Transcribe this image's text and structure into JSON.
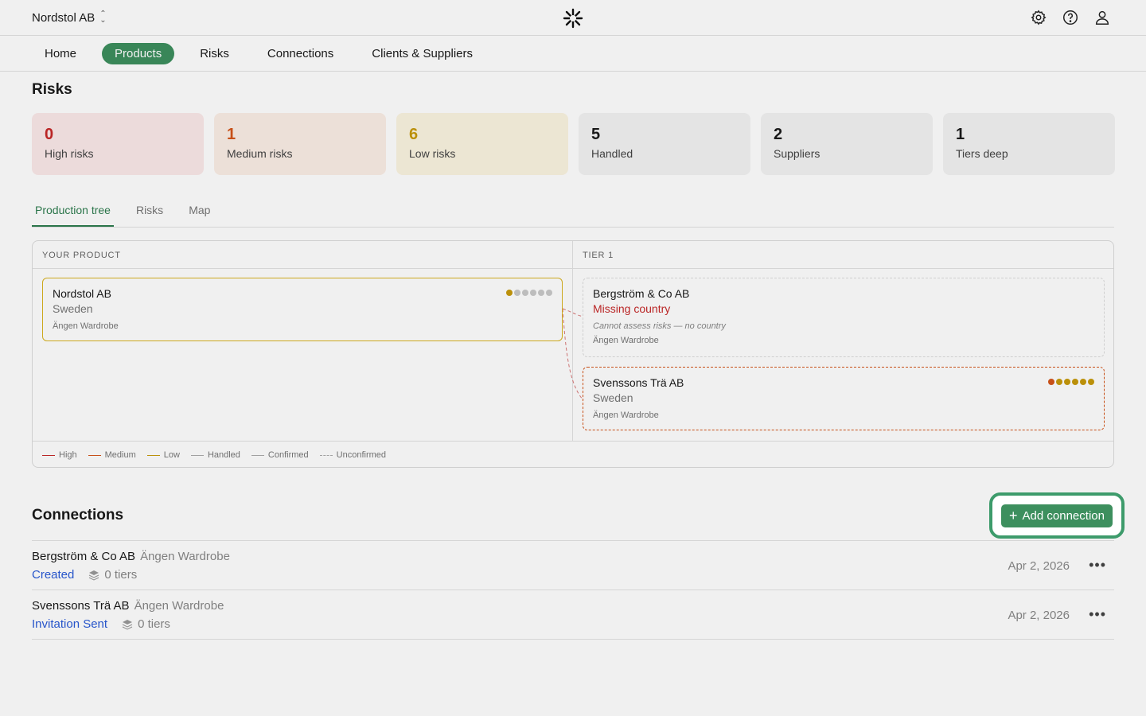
{
  "header": {
    "org_name": "Nordstol AB",
    "icons": [
      "settings-icon",
      "help-icon",
      "user-icon"
    ]
  },
  "nav": {
    "items": [
      {
        "label": "Home"
      },
      {
        "label": "Products"
      },
      {
        "label": "Risks"
      },
      {
        "label": "Connections"
      },
      {
        "label": "Clients & Suppliers"
      }
    ],
    "active": "Products"
  },
  "risks": {
    "title": "Risks",
    "stats": [
      {
        "value": "0",
        "label": "High risks"
      },
      {
        "value": "1",
        "label": "Medium risks"
      },
      {
        "value": "6",
        "label": "Low risks"
      },
      {
        "value": "5",
        "label": "Handled"
      },
      {
        "value": "2",
        "label": "Suppliers"
      },
      {
        "value": "1",
        "label": "Tiers deep"
      }
    ]
  },
  "tabs": {
    "items": [
      {
        "label": "Production tree"
      },
      {
        "label": "Risks"
      },
      {
        "label": "Map"
      }
    ],
    "active": "Production tree"
  },
  "tree": {
    "col_product": "YOUR PRODUCT",
    "col_tier": "TIER 1",
    "product": {
      "name": "Nordstol AB",
      "country": "Sweden",
      "product": "Ängen Wardrobe"
    },
    "suppliers": [
      {
        "name": "Bergström & Co AB",
        "country": "Missing country",
        "note": "Cannot assess risks — no country",
        "product": "Ängen Wardrobe"
      },
      {
        "name": "Svenssons Trä AB",
        "country": "Sweden",
        "product": "Ängen Wardrobe"
      }
    ],
    "legend": [
      "High",
      "Medium",
      "Low",
      "Handled",
      "Confirmed",
      "Unconfirmed"
    ],
    "colors": {
      "high": "#c62828",
      "medium": "#d4551a",
      "low": "#c79a0b",
      "handled": "#9e9e9e"
    }
  },
  "connections": {
    "title": "Connections",
    "add_label": "Add connection",
    "rows": [
      {
        "name": "Bergström & Co AB",
        "product": "Ängen Wardrobe",
        "status": "Created",
        "tiers": "0 tiers",
        "date": "Apr 2, 2026"
      },
      {
        "name": "Svenssons Trä AB",
        "product": "Ängen Wardrobe",
        "status": "Invitation Sent",
        "tiers": "0 tiers",
        "date": "Apr 2, 2026"
      }
    ]
  }
}
